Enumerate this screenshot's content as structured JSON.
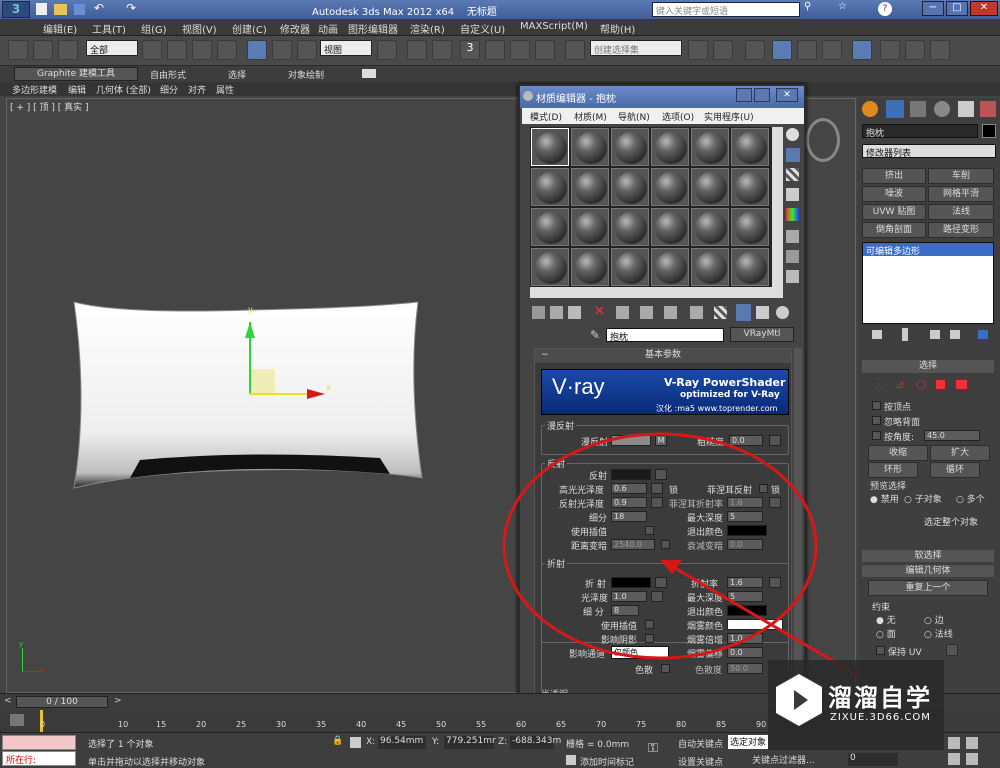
{
  "app": {
    "title": "Autodesk 3ds Max  2012 x64",
    "doc_title": "无标题",
    "search_placeholder": "键入关键字或短语",
    "help": "?"
  },
  "menu": [
    "编辑(E)",
    "工具(T)",
    "组(G)",
    "视图(V)",
    "创建(C)",
    "修改器",
    "动画",
    "图形编辑器",
    "渲染(R)",
    "自定义(U)",
    "MAXScript(M)",
    "帮助(H)"
  ],
  "toolbar": {
    "selection_filter": "全部",
    "ref_coord": "视图",
    "snap_label": "3",
    "named_sel": "创建选择集"
  },
  "ribbon": {
    "tabs": [
      "Graphite 建模工具",
      "自由形式",
      "选择",
      "对象绘制"
    ],
    "subtabs": [
      "多边形建模",
      "编辑",
      "几何体 (全部)",
      "细分",
      "对齐",
      "属性"
    ]
  },
  "viewport": {
    "label": "[ + ] [ 顶 ] [ 真实 ]",
    "gizmo_axis_y": "y",
    "gizmo_axis_x": "x",
    "corner_y": "y",
    "corner_x": "x"
  },
  "mat_editor": {
    "title": "材质编辑器 - 抱枕",
    "menu": [
      "模式(D)",
      "材质(M)",
      "导航(N)",
      "选项(O)",
      "实用程序(U)"
    ],
    "mat_name": "抱枕",
    "mat_type": "VRayMtl",
    "rollout_title": "基本参数",
    "banner_title": "V-Ray PowerShader",
    "banner_sub": "optimized for V-Ray",
    "banner_credit": "汉化 :ma5 www.toprender.com",
    "diffuse": {
      "group": "漫反射",
      "label": "漫反射",
      "map_btn": "M",
      "roughness_label": "粗糙度",
      "roughness": "0.0"
    },
    "reflection": {
      "group": "反射",
      "reflect": "反射",
      "hilight_gloss_label": "高光光泽度",
      "hilight_gloss": "0.6",
      "lock": "锁",
      "fresnel_label": "菲涅耳反射",
      "refl_gloss_label": "反射光泽度",
      "refl_gloss": "0.9",
      "fresnel_ior_label": "菲涅耳折射率",
      "fresnel_ior": "1.6",
      "subdivs_label": "细分",
      "subdivs": "18",
      "max_depth_label": "最大深度",
      "max_depth": "5",
      "interp_label": "使用插值",
      "exit_color_label": "退出颜色",
      "dim_dist_label": "距离变暗",
      "dim_dist": "2540.0",
      "dim_falloff_label": "衰减变暗",
      "dim_falloff": "0.0"
    },
    "refraction": {
      "group": "折射",
      "refract": "折 射",
      "ior_label": "折射率",
      "ior": "1.6",
      "gloss_label": "光泽度",
      "gloss": "1.0",
      "max_depth_label": "最大深度",
      "max_depth": "5",
      "subdivs_label": "细 分",
      "subdivs": "8",
      "exit_color_label": "退出颜色",
      "interp_label": "使用插值",
      "fog_color_label": "烟雾颜色",
      "shadows_label": "影响阴影",
      "fog_mult_label": "烟雾倍增",
      "fog_mult": "1.0",
      "channels_label": "影响通道",
      "channels_value": "仅颜色",
      "fog_bias_label": "烟雾偏移",
      "fog_bias": "0.0",
      "dispersion_label": "色散",
      "abbe_label": "色散度",
      "abbe": "50.0"
    },
    "next_rollout": "半透明"
  },
  "cmd_panel": {
    "object_name": "抱枕",
    "modifier_list": "修改器列表",
    "mod_buttons": [
      "挤出",
      "车削",
      "噪波",
      "网格平滑",
      "UVW 贴图",
      "法线",
      "倒角剖面",
      "路径变形"
    ],
    "stack_item": "可编辑多边形",
    "selection_title": "选择",
    "by_vertex": "按顶点",
    "ignore_back": "忽略背面",
    "by_angle": "按角度:",
    "angle": "45.0",
    "shrink": "收缩",
    "grow": "扩大",
    "ring": "环形",
    "loop": "循环",
    "preview_title": "预览选择",
    "preview_off": "禁用",
    "preview_sub": "子对象",
    "preview_multi": "多个",
    "select_whole": "选定整个对象",
    "soft_sel": "软选择",
    "edit_geo": "编辑几何体",
    "repeat_last": "重复上一个",
    "constraints": "约束",
    "c_none": "无",
    "c_edge": "边",
    "c_face": "面",
    "c_normal": "法线",
    "keep_uv": "保持 UV"
  },
  "timeline": {
    "frame": "0 / 100",
    "ticks": [
      "0",
      "10",
      "15",
      "20",
      "25",
      "30",
      "35",
      "40",
      "45",
      "50",
      "55",
      "60",
      "65",
      "70",
      "75",
      "80",
      "85",
      "90"
    ]
  },
  "status": {
    "in_scene": "所在行:",
    "message1": "选择了 1 个对象",
    "message2": "单击并拖动以选择并移动对象",
    "x_label": "X:",
    "x": "96.54mm",
    "y_label": "Y:",
    "y": "779.251mr",
    "z_label": "Z:",
    "z": "-688.343m",
    "grid": "栅格 = 0.0mm",
    "add_time_tag": "添加时间标记",
    "auto_key": "自动关键点",
    "auto_key_sel": "选定对象",
    "set_key": "设置关键点",
    "key_filters": "关键点过滤器...",
    "frame_field": "0"
  },
  "watermark": {
    "brand": "溜溜自学",
    "url": "ZIXUE.3D66.COM"
  },
  "colors": {
    "accent": "#4a6aa8",
    "annotation": "#d81818"
  }
}
